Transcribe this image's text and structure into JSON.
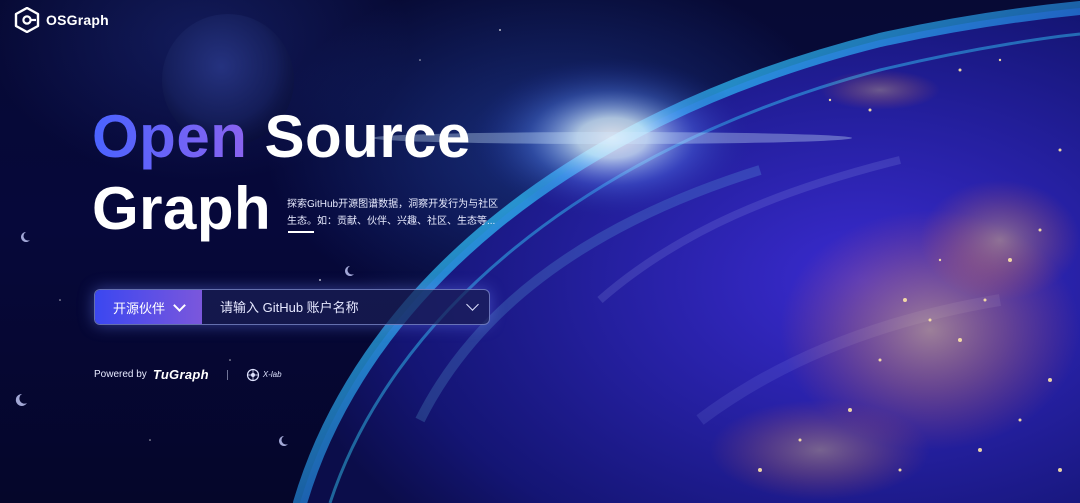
{
  "brand": {
    "name": "OSGraph",
    "logo_icon": "osgraph-logo-icon"
  },
  "hero": {
    "title_accent": "Open",
    "title_rest": "Source",
    "title_line2": "Graph",
    "tagline": "探索GitHub开源图谱数据，洞察开发行为与社区生态。如：贡献、伙伴、兴趣、社区、生态等..."
  },
  "search": {
    "type_label": "开源伙伴",
    "type_icon": "chevron-down-icon",
    "input_value": "",
    "placeholder": "请输入 GitHub 账户名称",
    "dropdown_icon": "chevron-down-icon"
  },
  "footer": {
    "powered_by": "Powered by",
    "tugraph": "TuGraph",
    "xlab": "X-lab"
  },
  "colors": {
    "accent_start": "#4a63ff",
    "accent_end": "#8a63f0",
    "background": "#05062a"
  }
}
